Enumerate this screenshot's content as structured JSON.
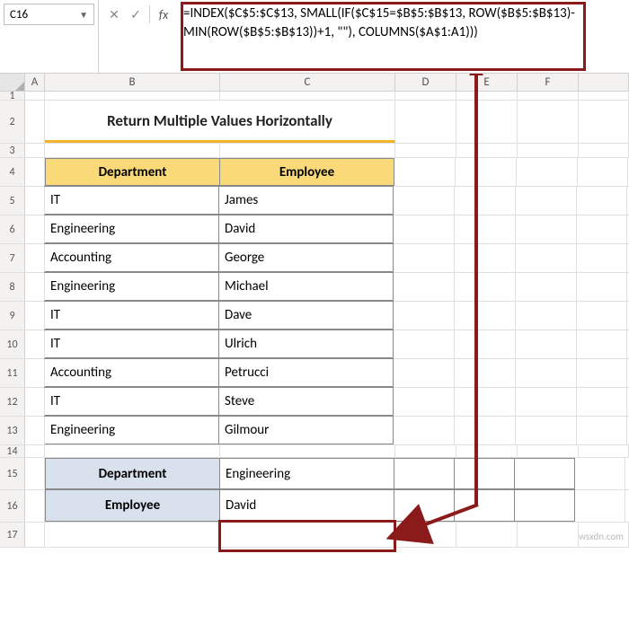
{
  "namebox": {
    "value": "C16"
  },
  "formula_bar": {
    "formula": "=INDEX($C$5:$C$13, SMALL(IF($C$15=$B$5:$B$13, ROW($B$5:$B$13)-MIN(ROW($B$5:$B$13))+1, \"\"), COLUMNS($A$1:A1)))"
  },
  "columns": {
    "A": "A",
    "B": "B",
    "C": "C",
    "D": "D",
    "E": "E",
    "F": "F"
  },
  "rows": [
    "1",
    "2",
    "3",
    "4",
    "5",
    "6",
    "7",
    "8",
    "9",
    "10",
    "11",
    "12",
    "13",
    "14",
    "15",
    "16",
    "17"
  ],
  "title": "Return Multiple Values Horizontally",
  "table": {
    "headers": {
      "dept": "Department",
      "emp": "Employee"
    },
    "rows": [
      {
        "dept": "IT",
        "emp": "James"
      },
      {
        "dept": "Engineering",
        "emp": "David"
      },
      {
        "dept": "Accounting",
        "emp": "George"
      },
      {
        "dept": "Engineering",
        "emp": "Michael"
      },
      {
        "dept": "IT",
        "emp": "Dave"
      },
      {
        "dept": "IT",
        "emp": "Ulrich"
      },
      {
        "dept": "Accounting",
        "emp": "Petrucci"
      },
      {
        "dept": "IT",
        "emp": "Steve"
      },
      {
        "dept": "Engineering",
        "emp": "Gilmour"
      }
    ]
  },
  "lookup": {
    "dept_label": "Department",
    "emp_label": "Employee",
    "dept_value": "Engineering",
    "emp_result": "David"
  },
  "watermark": "wsxdn.com"
}
